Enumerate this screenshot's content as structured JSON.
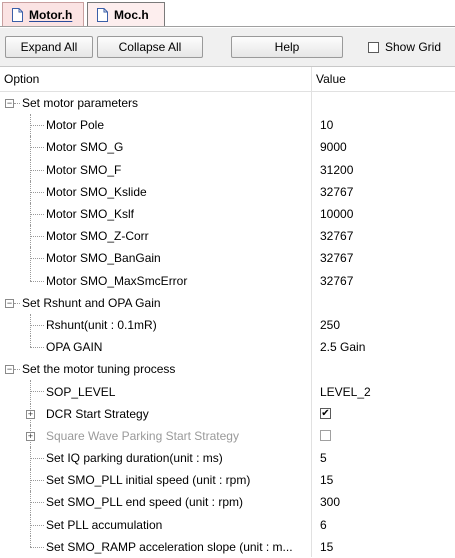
{
  "tabs": [
    {
      "label": "Motor.h",
      "active": true
    },
    {
      "label": "Moc.h",
      "active": false
    }
  ],
  "toolbar": {
    "expand_all": "Expand All",
    "collapse_all": "Collapse All",
    "help": "Help",
    "show_grid": "Show Grid",
    "show_grid_checked": false
  },
  "grid": {
    "header_option": "Option",
    "header_value": "Value",
    "groups": [
      {
        "label": "Set motor parameters",
        "items": [
          {
            "label": "Motor Pole",
            "value": "10"
          },
          {
            "label": "Motor SMO_G",
            "value": "9000"
          },
          {
            "label": "Motor SMO_F",
            "value": "31200"
          },
          {
            "label": "Motor SMO_Kslide",
            "value": "32767"
          },
          {
            "label": "Motor SMO_Kslf",
            "value": "10000"
          },
          {
            "label": "Motor SMO_Z-Corr",
            "value": "32767"
          },
          {
            "label": "Motor SMO_BanGain",
            "value": "32767"
          },
          {
            "label": "Motor SMO_MaxSmcError",
            "value": "32767"
          }
        ]
      },
      {
        "label": "Set Rshunt and OPA Gain",
        "items": [
          {
            "label": "Rshunt(unit : 0.1mR)",
            "value": "250"
          },
          {
            "label": "OPA GAIN",
            "value": "2.5 Gain"
          }
        ]
      },
      {
        "label": "Set the motor tuning process",
        "items": [
          {
            "label": "SOP_LEVEL",
            "value": "LEVEL_2"
          },
          {
            "label": "DCR Start Strategy",
            "value": "✔"
          },
          {
            "label": "Square Wave Parking Start Strategy",
            "value": ""
          },
          {
            "label": "Set IQ parking duration(unit : ms)",
            "value": "5"
          },
          {
            "label": "Set SMO_PLL initial speed (unit : rpm)",
            "value": "15"
          },
          {
            "label": "Set SMO_PLL end speed (unit : rpm)",
            "value": "300"
          },
          {
            "label": "Set PLL accumulation",
            "value": "6"
          },
          {
            "label": "Set SMO_RAMP acceleration slope (unit : m...",
            "value": "15"
          }
        ]
      }
    ]
  }
}
